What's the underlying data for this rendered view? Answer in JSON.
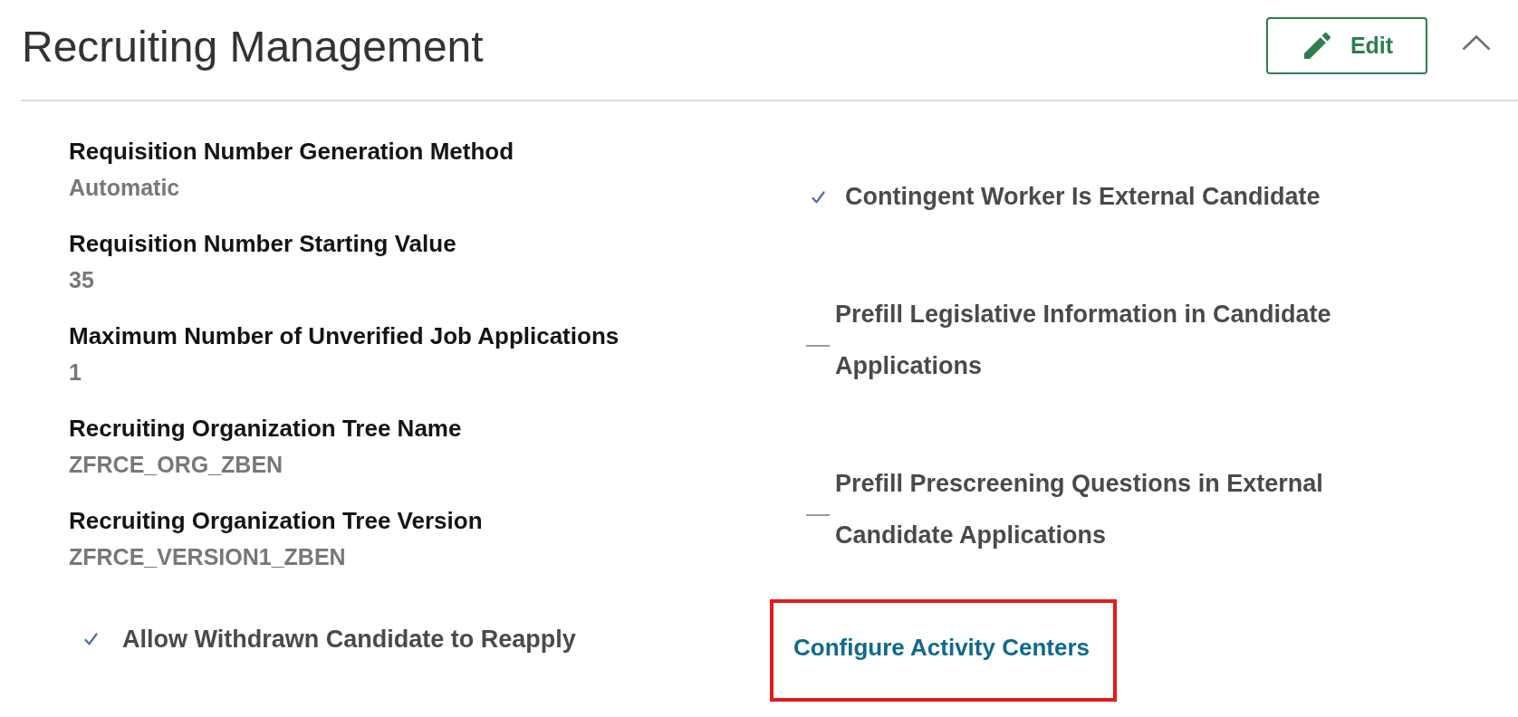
{
  "header": {
    "title": "Recruiting Management",
    "edit_button": "Edit",
    "expanded": true
  },
  "fields": [
    {
      "label": "Requisition Number Generation Method",
      "value": "Automatic"
    },
    {
      "label": "Requisition Number Starting Value",
      "value": "35"
    },
    {
      "label": "Maximum Number of Unverified Job Applications",
      "value": "1"
    },
    {
      "label": "Recruiting Organization Tree Name",
      "value": "ZFRCE_ORG_ZBEN"
    },
    {
      "label": "Recruiting Organization Tree Version",
      "value": "ZFRCE_VERSION1_ZBEN"
    }
  ],
  "left_options": [
    {
      "label": "Allow Withdrawn Candidate to Reapply",
      "checked": true
    }
  ],
  "right_options": [
    {
      "label": "Contingent Worker Is External Candidate",
      "checked": true
    },
    {
      "label": "Prefill Legislative Information in Candidate Applications",
      "checked": false
    },
    {
      "label": "Prefill Prescreening Questions in External Candidate Applications",
      "checked": false
    }
  ],
  "configure_link": {
    "label": "Configure Activity Centers",
    "highlighted": true
  }
}
